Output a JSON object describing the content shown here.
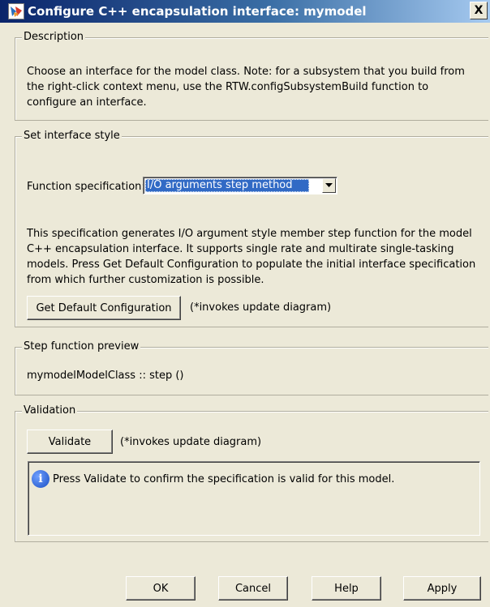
{
  "window": {
    "title": "Configure C++ encapsulation interface: mymodel",
    "close_glyph": "X"
  },
  "description": {
    "legend": "Description",
    "text": "Choose an interface for the model class. Note: for a subsystem that you build from the right-click context menu, use the RTW.configSubsystemBuild function to configure an interface."
  },
  "interface_style": {
    "legend": "Set interface style",
    "function_spec_label": "Function specification:",
    "function_spec_value": "I/O arguments step method",
    "explanation": "This specification generates I/O argument style member step function for the model C++ encapsulation interface. It supports single rate and multirate single-tasking models.  Press Get Default Configuration to populate the initial interface specification from which further customization is possible.",
    "get_default_label": "Get Default Configuration",
    "get_default_note": "(*invokes update diagram)"
  },
  "preview": {
    "legend": "Step function preview",
    "text": "mymodelModelClass :: step ()"
  },
  "validation": {
    "legend": "Validation",
    "validate_label": "Validate",
    "validate_note": "(*invokes update diagram)",
    "message": "Press Validate to confirm the specification is valid for this model."
  },
  "buttons": {
    "ok": "OK",
    "cancel": "Cancel",
    "help": "Help",
    "apply": "Apply"
  },
  "colors": {
    "titlebar_start": "#0a246a",
    "titlebar_end": "#a6caf0",
    "dialog_bg": "#ece9d8",
    "selection": "#316ac5"
  }
}
